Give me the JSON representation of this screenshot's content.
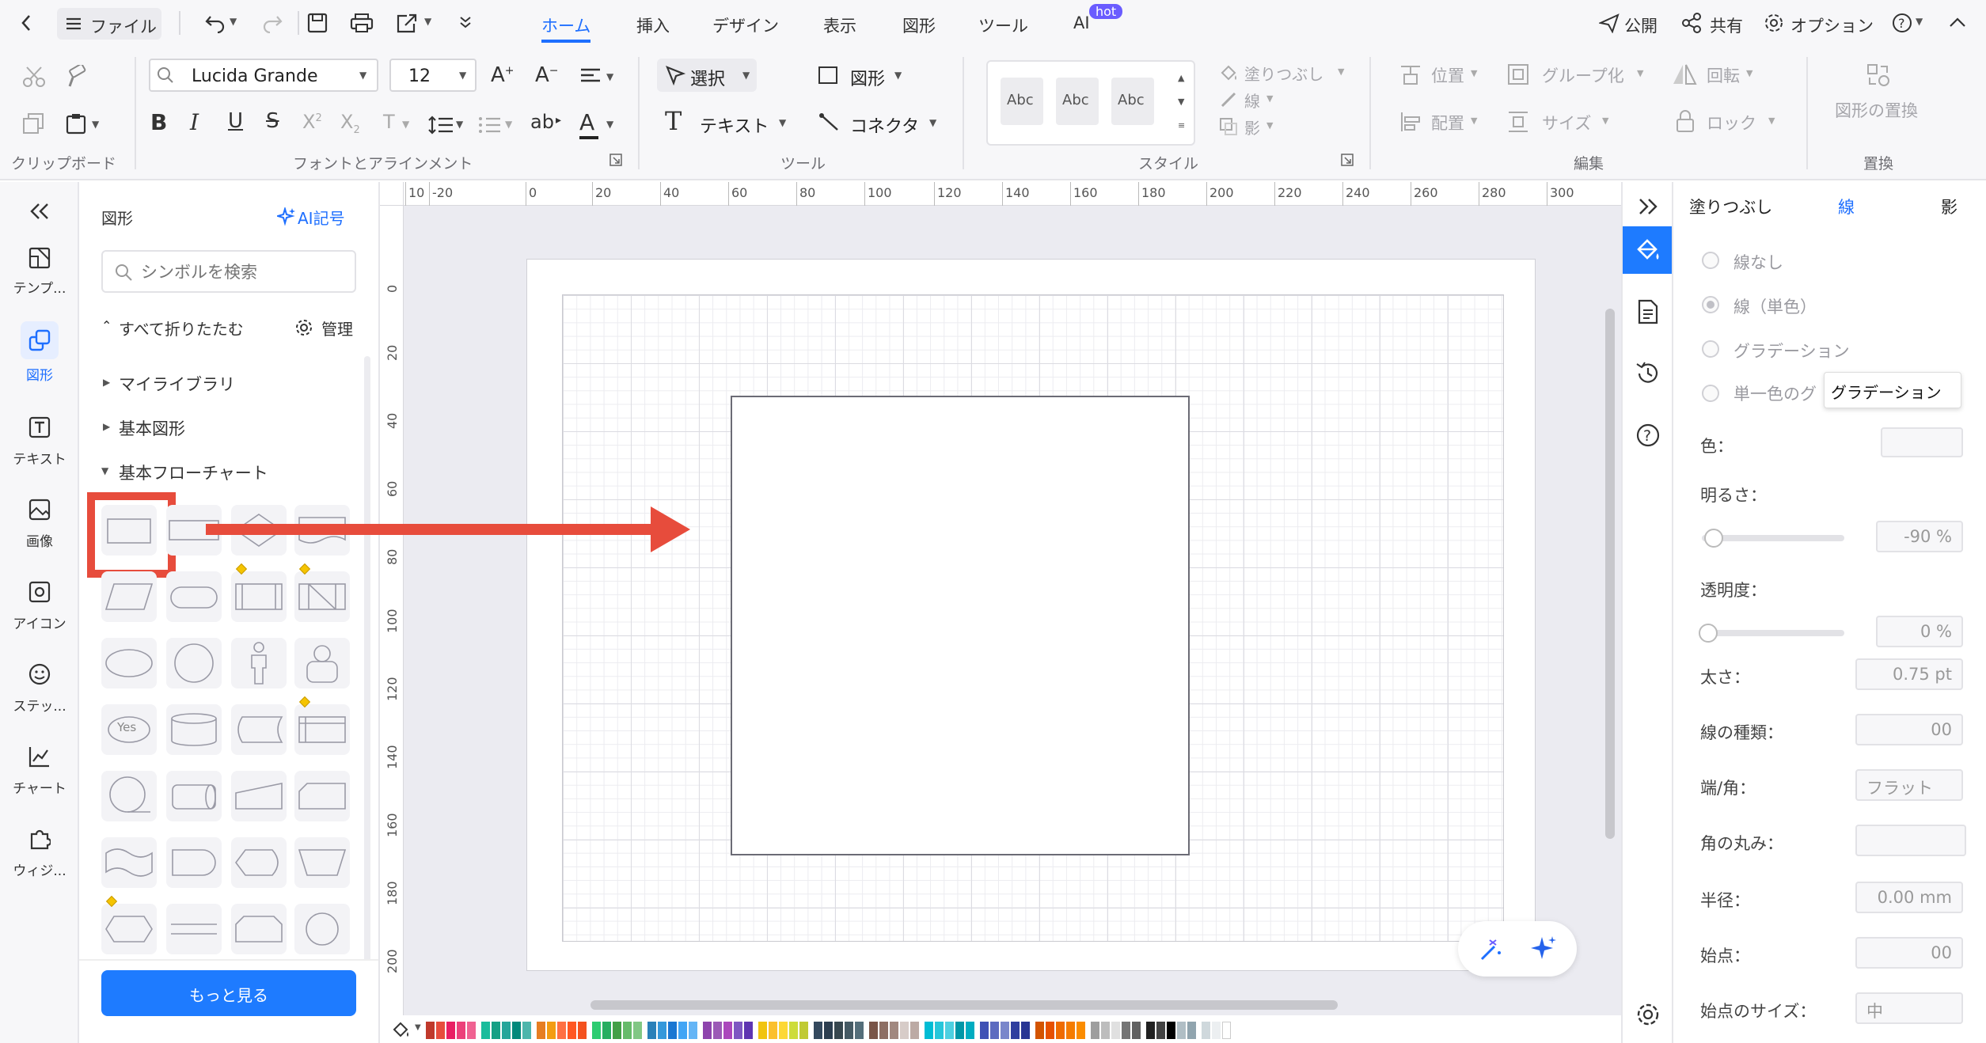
{
  "menubar": {
    "file_label": "ファイル",
    "tabs": [
      "ホーム",
      "挿入",
      "デザイン",
      "表示",
      "図形",
      "ツール",
      "AI"
    ],
    "ai_badge": "hot",
    "publish": "公開",
    "share": "共有",
    "options": "オプション"
  },
  "ribbon": {
    "font_name": "Lucida Grande",
    "font_size": "12",
    "select_label": "選択",
    "shape_label": "図形",
    "text_label": "テキスト",
    "connector_label": "コネクタ",
    "style_sample": "Abc",
    "fill_label": "塗りつぶし",
    "line_label": "線",
    "shadow_label": "影",
    "position_label": "位置",
    "group_label": "グループ化",
    "rotate_label": "回転",
    "arrange_label": "配置",
    "size_label": "サイズ",
    "lock_label": "ロック",
    "replace_label": "図形の置換",
    "groups": {
      "clipboard": "クリップボード",
      "font": "フォントとアラインメント",
      "tools": "ツール",
      "style": "スタイル",
      "edit": "編集",
      "replace": "置換"
    }
  },
  "leftrail": {
    "items": [
      "テンプ...",
      "図形",
      "テキスト",
      "画像",
      "アイコン",
      "ステッ...",
      "チャート",
      "ウィジ..."
    ]
  },
  "library": {
    "title": "図形",
    "ai_symbol": "AI記号",
    "search_placeholder": "シンボルを検索",
    "collapse_all": "すべて折りたたむ",
    "manage": "管理",
    "sections": [
      "マイライブラリ",
      "基本図形",
      "基本フローチャート"
    ],
    "yes_label": "Yes",
    "more_button": "もっと見る"
  },
  "canvas": {
    "ruler_top": [
      "10",
      "-20",
      "0",
      "20",
      "40",
      "60",
      "80",
      "100",
      "120",
      "140",
      "160",
      "180",
      "200",
      "220",
      "240",
      "260",
      "280",
      "300"
    ],
    "ruler_left": [
      "0",
      "20",
      "40",
      "60",
      "80",
      "100",
      "120",
      "140",
      "160",
      "180",
      "200"
    ]
  },
  "props": {
    "tabs": [
      "塗りつぶし",
      "線",
      "影"
    ],
    "options": [
      "線なし",
      "線（単色）",
      "グラデーション",
      "単一色のグ"
    ],
    "tooltip": "グラデーション",
    "color_label": "色：",
    "brightness_label": "明るさ：",
    "brightness_value": "-90 %",
    "brightness_level": 0.05,
    "transparency_label": "透明度：",
    "transparency_value": "0 %",
    "transparency_level": 0,
    "width_label": "太さ：",
    "width_value": "0.75 pt",
    "linetype_label": "線の種類：",
    "linetype_value": "00",
    "cap_label": "端/角：",
    "cap_value": "フラット",
    "round_label": "角の丸み：",
    "radius_label": "半径：",
    "radius_value": "0.00 mm",
    "start_label": "始点：",
    "start_value": "00",
    "startsize_label": "始点のサイズ：",
    "startsize_value": "中"
  },
  "colors": {
    "accent": "#1e6fff",
    "highlight": "#e74c3c",
    "palette": [
      "#c0392b",
      "#e74c3c",
      "#e91e63",
      "#ec407a",
      "#f06292",
      "#1abc9c",
      "#16a085",
      "#26a69a",
      "#00897b",
      "#4db6ac",
      "#e67e22",
      "#f39c12",
      "#ff7043",
      "#ff5722",
      "#f4511e",
      "#2ecc71",
      "#27ae60",
      "#43a047",
      "#66bb6a",
      "#81c784",
      "#2980b9",
      "#3498db",
      "#1976d2",
      "#42a5f5",
      "#64b5f6",
      "#8e44ad",
      "#9b59b6",
      "#ab47bc",
      "#7e57c2",
      "#5e35b1",
      "#f1c40f",
      "#fbc02d",
      "#fdd835",
      "#cddc39",
      "#c0ca33",
      "#34495e",
      "#2c3e50",
      "#37474f",
      "#455a64",
      "#546e7a",
      "#795548",
      "#8d6e63",
      "#a1887f",
      "#d7ccc8",
      "#bcaaa4",
      "#00bcd4",
      "#26c6da",
      "#4dd0e1",
      "#0097a7",
      "#00acc1",
      "#3f51b5",
      "#5c6bc0",
      "#7986cb",
      "#303f9f",
      "#283593",
      "#d35400",
      "#e65100",
      "#ef6c00",
      "#f57c00",
      "#fb8c00",
      "#9e9e9e",
      "#bdbdbd",
      "#e0e0e0",
      "#757575",
      "#616161",
      "#212121",
      "#424242",
      "#000000",
      "#b0bec5",
      "#90a4ae",
      "#cfd8dc",
      "#eceff1",
      "#ffffff"
    ]
  }
}
